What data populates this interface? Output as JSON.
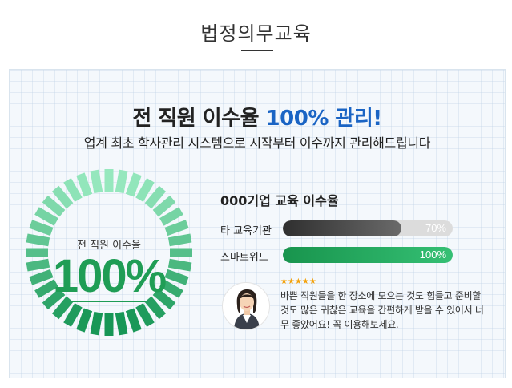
{
  "section": {
    "title": "법정의무교육"
  },
  "panel": {
    "headline_main": "전 직원 이수율 ",
    "headline_accent": "100% 관리!",
    "subline": "업계 최초 학사관리 시스템으로 시작부터 이수까지 관리해드립니다"
  },
  "gauge": {
    "label": "전 직원 이수율",
    "value_text": "100%",
    "level": 1.0,
    "color": "#1f9d55"
  },
  "comparison": {
    "title": "000기업 교육 이수율",
    "rows": [
      {
        "label": "타 교육기관",
        "value_text": "70%",
        "level": 0.7,
        "style": "gray"
      },
      {
        "label": "스마트위드",
        "value_text": "100%",
        "level": 1.0,
        "style": "green"
      }
    ]
  },
  "review": {
    "stars": "★★★★★",
    "rating": 5,
    "avatar_icon": "woman-avatar-icon",
    "text": "바쁜 직원들을 한 장소에 모으는 것도 힘들고 준비할 것도 많은 귀찮은 교육을 간편하게 받을 수 있어서 너무 좋았어요! 꼭 이용해보세요."
  },
  "colors": {
    "accent_blue": "#1a64c4",
    "accent_green": "#1f9d55",
    "star": "#f4a20b"
  }
}
